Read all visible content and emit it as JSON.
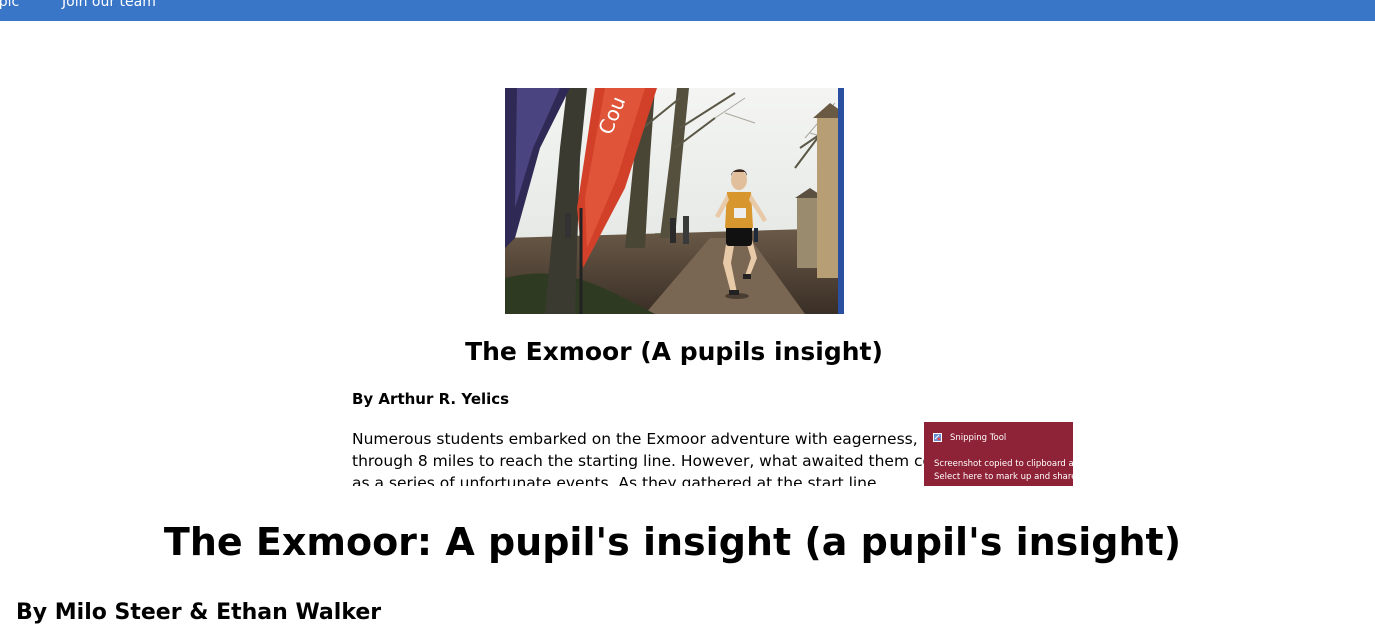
{
  "nav": {
    "items": [
      {
        "label": "Topic"
      },
      {
        "label": "Join our team"
      }
    ],
    "color": "#3a76c8"
  },
  "hero_image": {
    "alt": "Runner on a muddy path between trees past flags",
    "flag_text": "Cou"
  },
  "article": {
    "title": "The Exmoor (A pupils insight)",
    "byline": "By Arthur R. Yelics",
    "body": "Numerous students embarked on the Exmoor adventure with eagerness, prepared to trudge through 8 miles to reach the starting line. However, what awaited them could be described as a series of unfortunate events. As they gathered at the start line"
  },
  "toast": {
    "app_name": "Snipping Tool",
    "line1": "Screenshot copied to clipboard and saved",
    "line2": "Select here to mark up and share.",
    "icon": "snipping-tool-icon",
    "color": "#8e2236"
  },
  "main": {
    "title": "The Exmoor: A pupil's insight (a pupil's insight)",
    "byline": "By Milo Steer & Ethan Walker"
  }
}
